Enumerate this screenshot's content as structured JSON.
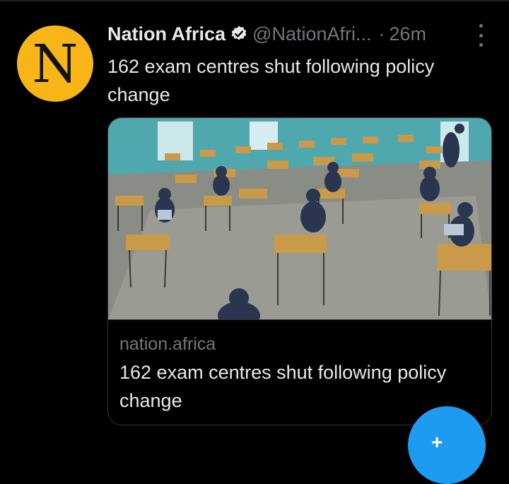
{
  "tweet": {
    "avatar_letter": "N",
    "display_name": "Nation Africa",
    "handle": "@NationAfri...",
    "separator": "·",
    "time": "26m",
    "text": "162 exam centres shut following policy change"
  },
  "card": {
    "domain": "nation.africa",
    "title": "162 exam centres shut following policy change"
  },
  "fab": {
    "plus": "+"
  },
  "icons": {
    "verified": "verified-badge-icon",
    "more": "more-vertical-icon",
    "compose": "compose-icon"
  },
  "colors": {
    "avatar_bg": "#f7b517",
    "accent": "#1d9bf0",
    "muted": "#71767b",
    "text": "#e7e9ea"
  }
}
